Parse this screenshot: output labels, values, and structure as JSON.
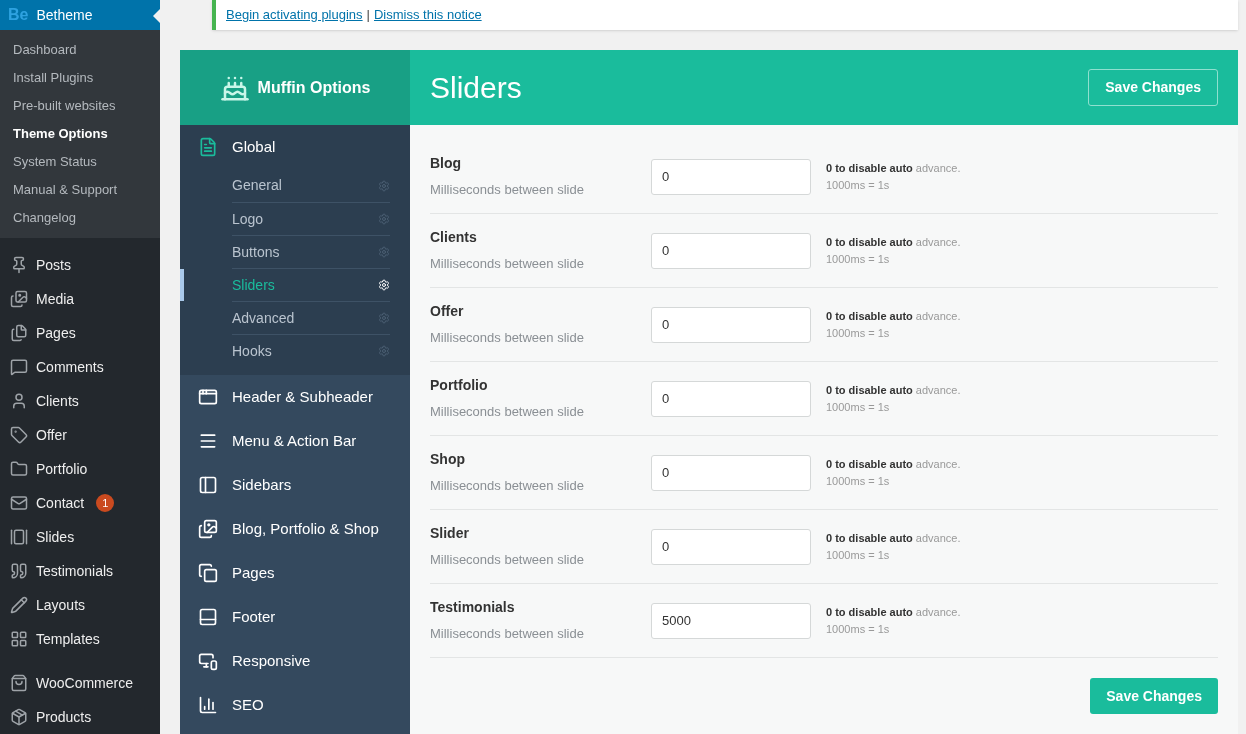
{
  "admin_menu": {
    "current": {
      "logo": "Be",
      "label": "Betheme"
    },
    "submenu": [
      {
        "label": "Dashboard",
        "selected": false
      },
      {
        "label": "Install Plugins",
        "selected": false
      },
      {
        "label": "Pre-built websites",
        "selected": false
      },
      {
        "label": "Theme Options",
        "selected": true
      },
      {
        "label": "System Status",
        "selected": false
      },
      {
        "label": "Manual & Support",
        "selected": false
      },
      {
        "label": "Changelog",
        "selected": false
      }
    ],
    "items": [
      {
        "label": "Posts"
      },
      {
        "label": "Media"
      },
      {
        "label": "Pages"
      },
      {
        "label": "Comments"
      },
      {
        "label": "Clients"
      },
      {
        "label": "Offer"
      },
      {
        "label": "Portfolio"
      },
      {
        "label": "Contact",
        "badge": "1"
      },
      {
        "label": "Slides"
      },
      {
        "label": "Testimonials"
      },
      {
        "label": "Layouts"
      },
      {
        "label": "Templates"
      },
      {
        "label": "WooCommerce"
      },
      {
        "label": "Products"
      }
    ]
  },
  "notice": {
    "links": [
      "Begin activating plugins",
      "Dismiss this notice"
    ],
    "separator": "|"
  },
  "options": {
    "brand": "Muffin Options",
    "title": "Sliders",
    "save_label": "Save Changes",
    "nav": [
      {
        "label": "Global",
        "expanded": true,
        "children": [
          {
            "label": "General",
            "selected": false
          },
          {
            "label": "Logo",
            "selected": false
          },
          {
            "label": "Buttons",
            "selected": false
          },
          {
            "label": "Sliders",
            "selected": true
          },
          {
            "label": "Advanced",
            "selected": false
          },
          {
            "label": "Hooks",
            "selected": false
          }
        ]
      },
      {
        "label": "Header & Subheader",
        "expanded": false
      },
      {
        "label": "Menu & Action Bar",
        "expanded": false
      },
      {
        "label": "Sidebars",
        "expanded": false
      },
      {
        "label": "Blog, Portfolio & Shop",
        "expanded": false
      },
      {
        "label": "Pages",
        "expanded": false
      },
      {
        "label": "Footer",
        "expanded": false
      },
      {
        "label": "Responsive",
        "expanded": false
      },
      {
        "label": "SEO",
        "expanded": false
      }
    ],
    "fields": [
      {
        "label": "Blog",
        "description": "Milliseconds between slide",
        "value": "0",
        "hint": "**0 to disable auto** advance.",
        "hint_2": "1000ms = 1s"
      },
      {
        "label": "Clients",
        "description": "Milliseconds between slide",
        "value": "0",
        "hint": "**0 to disable auto** advance.",
        "hint_2": "1000ms = 1s"
      },
      {
        "label": "Offer",
        "description": "Milliseconds between slide",
        "value": "0",
        "hint": "**0 to disable auto** advance.",
        "hint_2": "1000ms = 1s"
      },
      {
        "label": "Portfolio",
        "description": "Milliseconds between slide",
        "value": "0",
        "hint": "**0 to disable auto** advance.",
        "hint_2": "1000ms = 1s"
      },
      {
        "label": "Shop",
        "description": "Milliseconds between slide",
        "value": "0",
        "hint": "**0 to disable auto** advance.",
        "hint_2": "1000ms = 1s"
      },
      {
        "label": "Slider",
        "description": "Milliseconds between slide",
        "value": "0",
        "hint": "**0 to disable auto** advance.",
        "hint_2": "1000ms = 1s"
      },
      {
        "label": "Testimonials",
        "description": "Milliseconds between slide",
        "value": "5000",
        "hint": "**0 to disable auto** advance.",
        "hint_2": "1000ms = 1s"
      }
    ],
    "footer_save_label": "Save Changes"
  }
}
